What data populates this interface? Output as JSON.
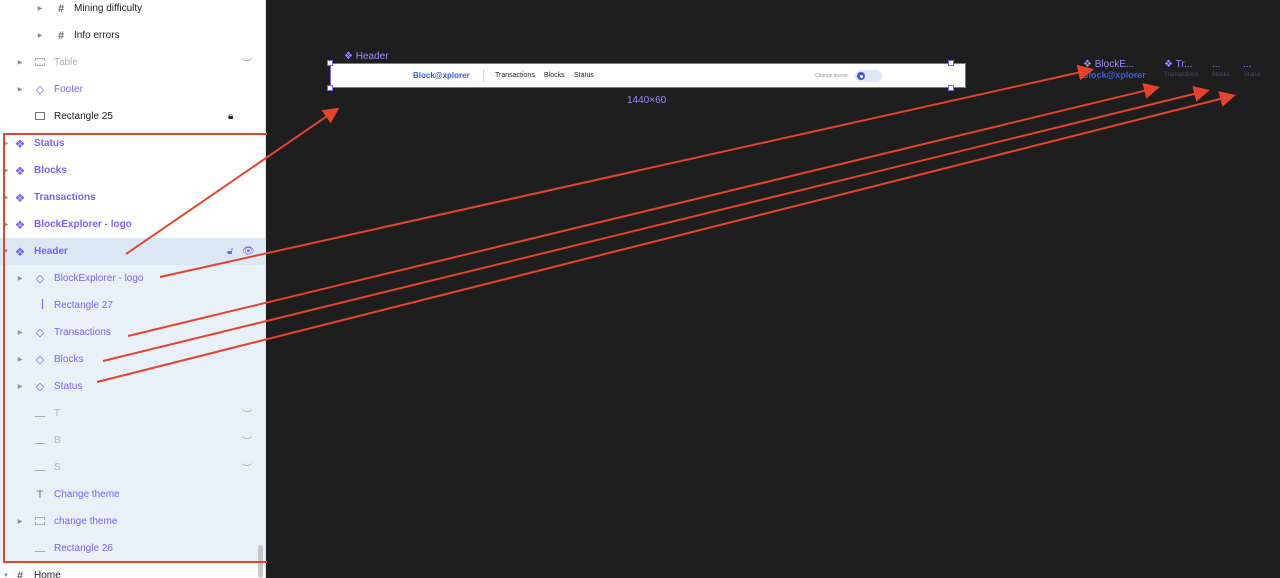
{
  "layers_panel": {
    "rows": [
      {
        "label": "Mining difficulty",
        "icon": "hash-icon"
      },
      {
        "label": "Info errors",
        "icon": "hash-icon"
      },
      {
        "label": "Table",
        "icon": "dashed-frame-icon"
      },
      {
        "label": "Footer",
        "icon": "component-instance-icon"
      },
      {
        "label": "Rectangle 25",
        "icon": "rectangle-icon"
      },
      {
        "label": "Status",
        "icon": "main-component-icon"
      },
      {
        "label": "Blocks",
        "icon": "main-component-icon"
      },
      {
        "label": "Transactions",
        "icon": "main-component-icon"
      },
      {
        "label": "BlockExplorer - logo",
        "icon": "main-component-icon"
      },
      {
        "label": "Header",
        "icon": "main-component-icon"
      },
      {
        "label": "BlockExplorer - logo",
        "icon": "component-instance-icon"
      },
      {
        "label": "Rectangle 27",
        "icon": "vertical-line-icon"
      },
      {
        "label": "Transactions",
        "icon": "component-instance-icon"
      },
      {
        "label": "Blocks",
        "icon": "component-instance-icon"
      },
      {
        "label": "Status",
        "icon": "component-instance-icon"
      },
      {
        "label": "T",
        "icon": "line-icon"
      },
      {
        "label": "B",
        "icon": "line-icon"
      },
      {
        "label": "S",
        "icon": "line-icon"
      },
      {
        "label": "Change theme",
        "icon": "text-icon"
      },
      {
        "label": "change theme",
        "icon": "dashed-frame-icon"
      },
      {
        "label": "Rectangle 26",
        "icon": "line-icon"
      },
      {
        "label": "Home",
        "icon": "hash-icon"
      }
    ]
  },
  "canvas": {
    "frame_label": "Header",
    "logo_text": "Block@xplorer",
    "nav": [
      "Transactions",
      "Blocks",
      "Status"
    ],
    "change_theme_label": "Change theme",
    "dimensions": "1440×60",
    "right_components": {
      "logo_label": "BlockE...",
      "logo_text": "Block@xplorer",
      "tr_label": "Tr...",
      "tr_sub": "Transactions",
      "bl_label": "...",
      "bl_sub": "Blocks",
      "st_label": "...",
      "st_sub": "Status"
    }
  },
  "colors": {
    "accent": "#7b61ff",
    "annotation": "#e5432c",
    "logo_blue": "#3b5bdb",
    "canvas_bg": "#1e1e1e"
  }
}
